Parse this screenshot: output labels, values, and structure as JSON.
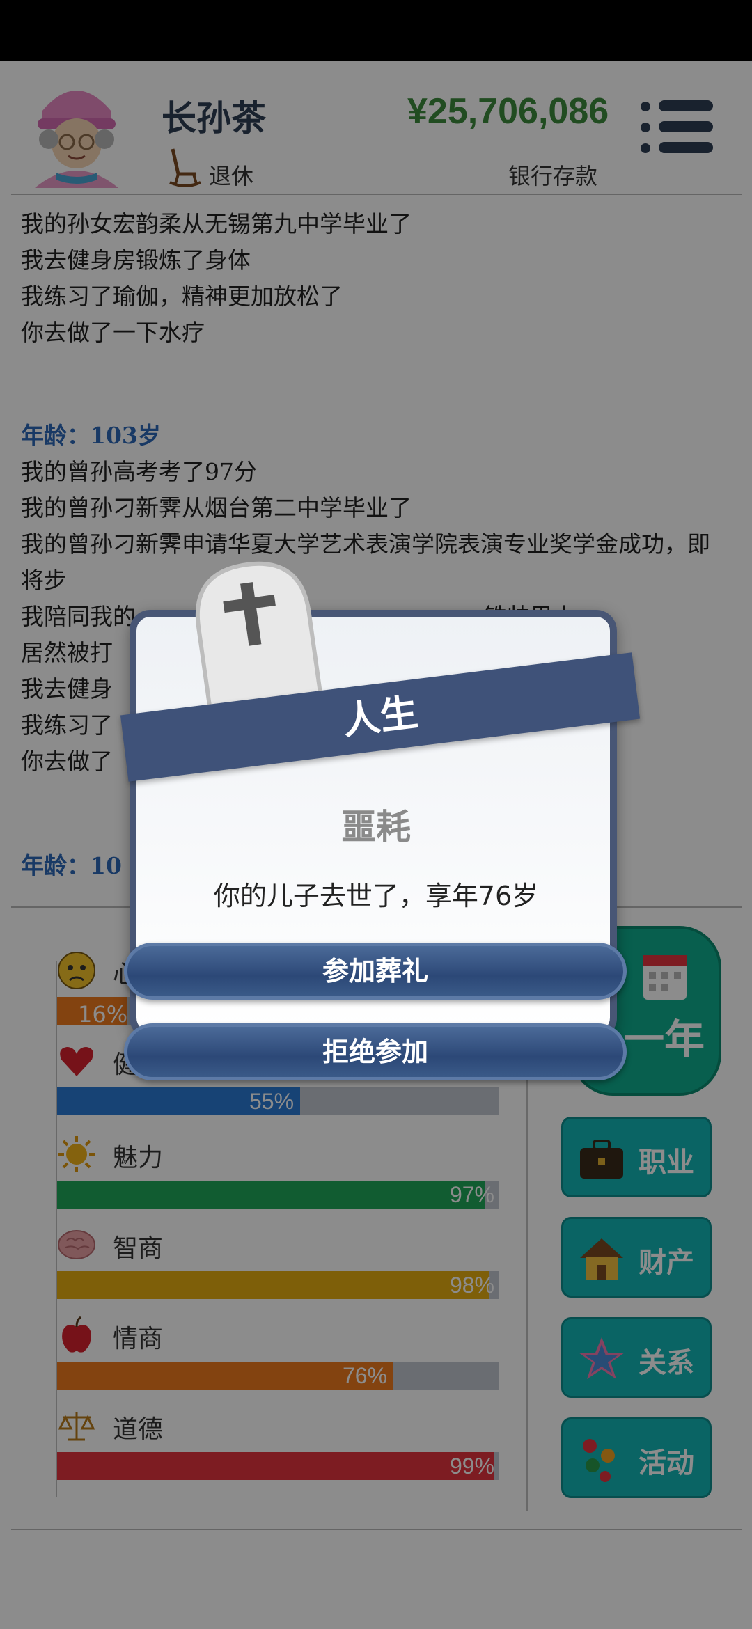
{
  "header": {
    "name": "长孙茶",
    "status": "退休",
    "money": "¥25,706,086",
    "money_label": "银行存款"
  },
  "log": {
    "lines1": [
      "我的孙女宏韵柔从无锡第九中学毕业了",
      "我去健身房锻炼了身体",
      "我练习了瑜伽，精神更加放松了",
      "你去做了一下水疗"
    ],
    "age1": "年龄：103岁",
    "lines2": [
      "我的曾孙高考考了97分",
      "我的曾孙刁新霁从烟台第二中学毕业了",
      "我的曾孙刁新霁申请华夏大学艺术表演学院表演专业奖学金成功，即将步",
      "我陪同我的",
      "居然被打",
      "我去健身",
      "我练习了",
      "你去做了"
    ],
    "line4_tail": "铁帅男人",
    "age2": "年龄：10"
  },
  "stats": [
    {
      "label": "心",
      "pct": "16%",
      "value": 16,
      "color": "#ee7a1e"
    },
    {
      "label": "健",
      "pct": "55%",
      "value": 55,
      "color": "#2a7ad6"
    },
    {
      "label": "魅力",
      "pct": "97%",
      "value": 97,
      "color": "#1fa85a"
    },
    {
      "label": "智商",
      "pct": "98%",
      "value": 98,
      "color": "#e5ad12"
    },
    {
      "label": "情商",
      "pct": "76%",
      "value": 76,
      "color": "#ee7a1e"
    },
    {
      "label": "道德",
      "pct": "99%",
      "value": 99,
      "color": "#e3343e"
    }
  ],
  "side": {
    "next_year": "一年",
    "career": "职业",
    "assets": "财产",
    "relations": "关系",
    "activities": "活动"
  },
  "dialog": {
    "title": "人生",
    "heading": "噩耗",
    "message": "你的儿子去世了，享年76岁",
    "btn_attend": "参加葬礼",
    "btn_decline": "拒绝参加"
  }
}
